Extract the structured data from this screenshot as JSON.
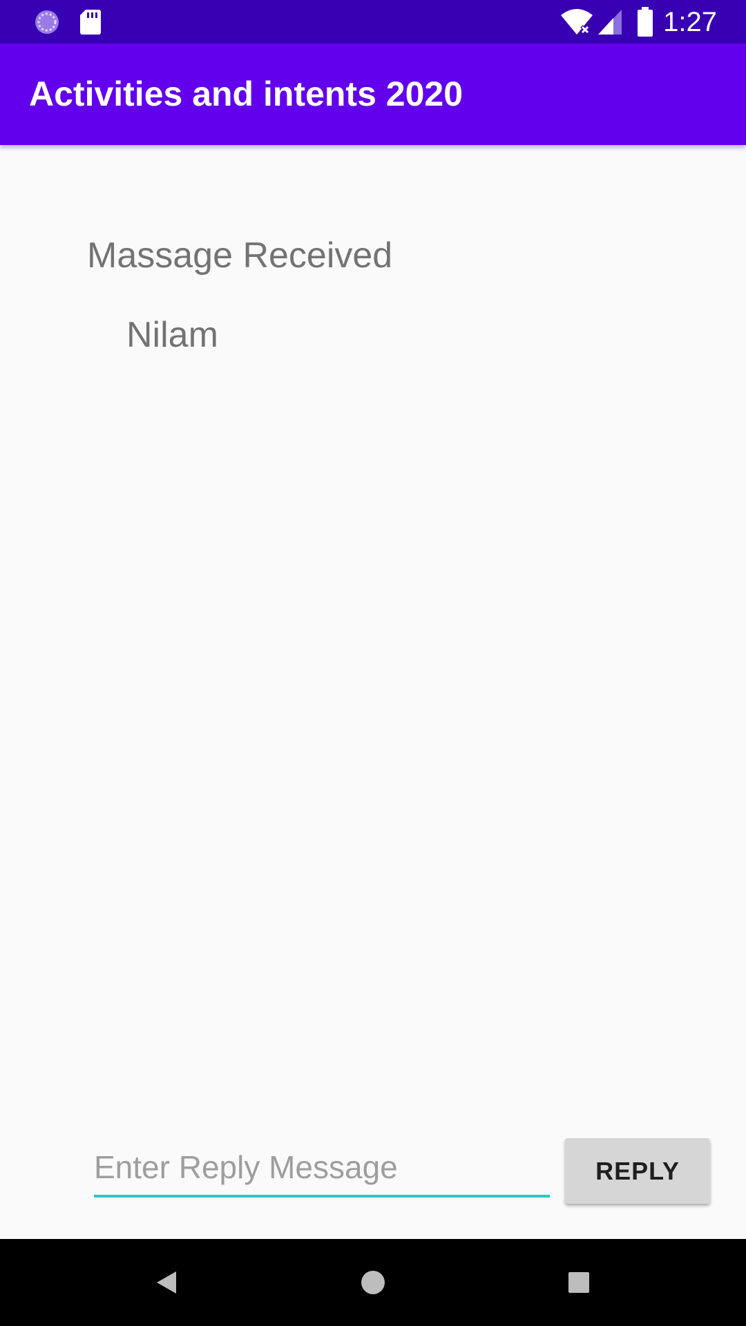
{
  "status_bar": {
    "time": "1:27",
    "left_icons": [
      "loading-spinner-icon",
      "sd-card-icon"
    ],
    "right_icons": [
      "wifi-off-icon",
      "cellular-signal-icon",
      "battery-icon"
    ],
    "background": "#3700b3"
  },
  "app_bar": {
    "title": "Activities and intents 2020",
    "background": "#6200ee"
  },
  "content": {
    "label": "Massage Received",
    "message": "Nilam"
  },
  "reply": {
    "input_value": "",
    "input_placeholder": "Enter Reply Message",
    "button_label": "REPLY",
    "accent": "#1fcfbf"
  },
  "nav_bar": {
    "buttons": [
      "back-icon",
      "home-icon",
      "recents-icon"
    ]
  }
}
